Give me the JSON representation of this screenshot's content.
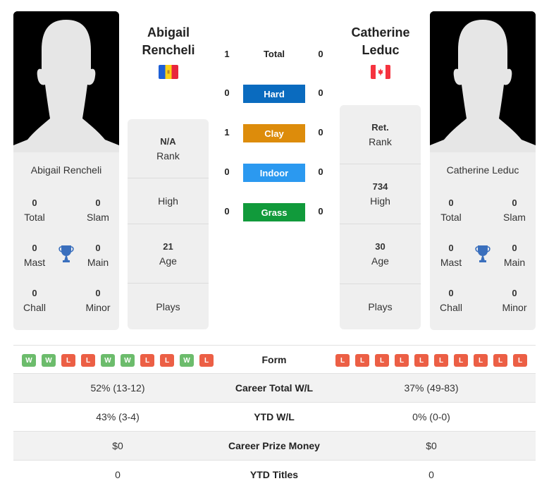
{
  "player1": {
    "name_line1": "Abigail",
    "name_line2": "Rencheli",
    "full_name": "Abigail Rencheli",
    "flag": "andorra-flag",
    "titles": {
      "total": {
        "value": "0",
        "label": "Total"
      },
      "slam": {
        "value": "0",
        "label": "Slam"
      },
      "mast": {
        "value": "0",
        "label": "Mast"
      },
      "main": {
        "value": "0",
        "label": "Main"
      },
      "chall": {
        "value": "0",
        "label": "Chall"
      },
      "minor": {
        "value": "0",
        "label": "Minor"
      }
    },
    "info": {
      "rank": {
        "value": "N/A",
        "label": "Rank"
      },
      "high": {
        "value": "",
        "label": "High"
      },
      "age": {
        "value": "21",
        "label": "Age"
      },
      "plays": {
        "value": "",
        "label": "Plays"
      }
    },
    "form": [
      "W",
      "W",
      "L",
      "L",
      "W",
      "W",
      "L",
      "L",
      "W",
      "L"
    ]
  },
  "player2": {
    "name_line1": "Catherine",
    "name_line2": "Leduc",
    "full_name": "Catherine Leduc",
    "flag": "canada-flag",
    "titles": {
      "total": {
        "value": "0",
        "label": "Total"
      },
      "slam": {
        "value": "0",
        "label": "Slam"
      },
      "mast": {
        "value": "0",
        "label": "Mast"
      },
      "main": {
        "value": "0",
        "label": "Main"
      },
      "chall": {
        "value": "0",
        "label": "Chall"
      },
      "minor": {
        "value": "0",
        "label": "Minor"
      }
    },
    "info": {
      "rank": {
        "value": "Ret.",
        "label": "Rank"
      },
      "high": {
        "value": "734",
        "label": "High"
      },
      "age": {
        "value": "30",
        "label": "Age"
      },
      "plays": {
        "value": "",
        "label": "Plays"
      }
    },
    "form": [
      "L",
      "L",
      "L",
      "L",
      "L",
      "L",
      "L",
      "L",
      "L",
      "L"
    ]
  },
  "h2h": {
    "total": {
      "label": "Total",
      "p1": "1",
      "p2": "0"
    },
    "surfaces": [
      {
        "label": "Hard",
        "p1": "0",
        "p2": "0",
        "color": "#0a6bbf"
      },
      {
        "label": "Clay",
        "p1": "1",
        "p2": "0",
        "color": "#dd8c0b"
      },
      {
        "label": "Indoor",
        "p1": "0",
        "p2": "0",
        "color": "#2b99f0"
      },
      {
        "label": "Grass",
        "p1": "0",
        "p2": "0",
        "color": "#119a3b"
      }
    ]
  },
  "form_label": "Form",
  "stats": [
    {
      "label": "Career Total W/L",
      "p1": "52% (13-12)",
      "p2": "37% (49-83)"
    },
    {
      "label": "YTD W/L",
      "p1": "43% (3-4)",
      "p2": "0% (0-0)"
    },
    {
      "label": "Career Prize Money",
      "p1": "$0",
      "p2": "$0"
    },
    {
      "label": "YTD Titles",
      "p1": "0",
      "p2": "0"
    }
  ]
}
